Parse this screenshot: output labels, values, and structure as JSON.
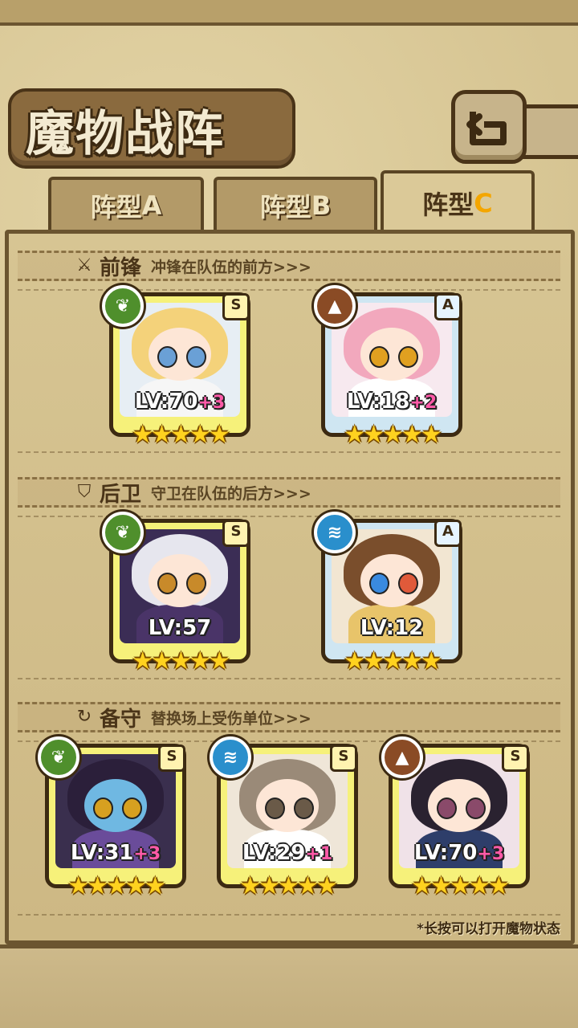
{
  "header": {
    "title": "魔物战阵"
  },
  "tabs": [
    {
      "prefix": "阵型",
      "letter": "A",
      "active": false
    },
    {
      "prefix": "阵型",
      "letter": "B",
      "active": false
    },
    {
      "prefix": "阵型",
      "letter": "C",
      "active": true
    }
  ],
  "sections": {
    "front": {
      "title": "前锋",
      "desc": "冲锋在队伍的前方>>>",
      "icon": "sword-icon"
    },
    "back": {
      "title": "后卫",
      "desc": "守卫在队伍的后方>>>",
      "icon": "shield-icon"
    },
    "reserve": {
      "title": "备守",
      "desc": "替换场上受伤单位>>>",
      "icon": "swap-icon"
    }
  },
  "cards": {
    "front": [
      {
        "rank": "S",
        "element": "leaf",
        "level": "LV:70",
        "plus": "+3",
        "stars": 5
      },
      {
        "rank": "A",
        "element": "earth",
        "level": "LV:18",
        "plus": "+2",
        "stars": 5
      }
    ],
    "back": [
      {
        "rank": "S",
        "element": "leaf",
        "level": "LV:57",
        "plus": "",
        "stars": 5
      },
      {
        "rank": "A",
        "element": "water",
        "level": "LV:12",
        "plus": "",
        "stars": 5
      }
    ],
    "reserve": [
      {
        "rank": "S",
        "element": "leaf",
        "level": "LV:31",
        "plus": "+3",
        "stars": 5
      },
      {
        "rank": "S",
        "element": "water",
        "level": "LV:29",
        "plus": "+1",
        "stars": 5
      },
      {
        "rank": "S",
        "element": "earth",
        "level": "LV:70",
        "plus": "+3",
        "stars": 5
      }
    ]
  },
  "footer": {
    "hint": "*长按可以打开魔物状态"
  },
  "colors": {
    "panel": "#d7c593",
    "frame": "#6b5530",
    "star": "#ffd21f",
    "plus": "#ff5aa8"
  }
}
